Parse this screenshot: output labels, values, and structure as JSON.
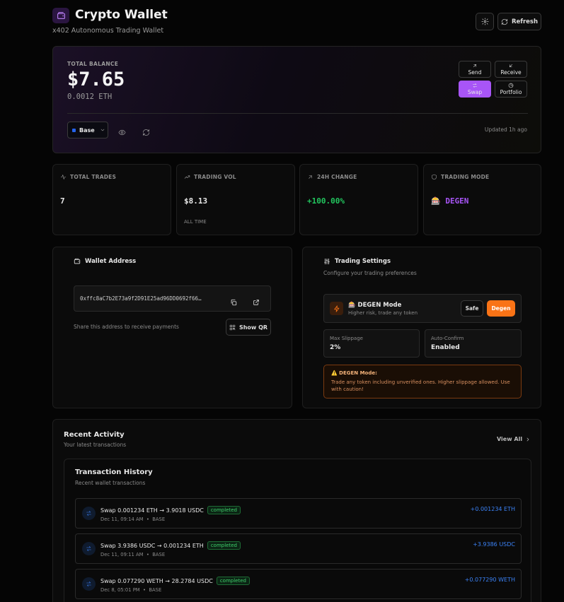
{
  "header": {
    "title": "Crypto Wallet",
    "subtitle": "x402 Autonomous Trading Wallet",
    "refresh_label": "Refresh"
  },
  "balance": {
    "label": "TOTAL BALANCE",
    "usd": "$7.65",
    "eth": "0.0012 ETH",
    "network": "Base",
    "updated": "Updated 1h ago",
    "actions": {
      "send": "Send",
      "receive": "Receive",
      "swap": "Swap",
      "portfolio": "Portfolio"
    }
  },
  "stats": [
    {
      "label": "TOTAL TRADES",
      "value": "7",
      "sub": ""
    },
    {
      "label": "TRADING VOL",
      "value": "$8.13",
      "sub": "ALL TIME"
    },
    {
      "label": "24H CHANGE",
      "value": "+100.00%",
      "sub": ""
    },
    {
      "label": "TRADING MODE",
      "value": "🎰 DEGEN",
      "sub": ""
    }
  ],
  "wallet": {
    "title": "Wallet Address",
    "address": "0xffc8aC7b2E73a9f2D91E25ad96DD0692f66…",
    "hint": "Share this address to receive payments",
    "qr_label": "Show QR"
  },
  "settings": {
    "title": "Trading Settings",
    "subtitle": "Configure your trading preferences",
    "mode_title": "🎰 DEGEN Mode",
    "mode_desc": "Higher risk, trade any token",
    "safe_label": "Safe",
    "degen_label": "Degen",
    "slippage_label": "Max Slippage",
    "slippage_value": "2%",
    "confirm_label": "Auto-Confirm",
    "confirm_value": "Enabled",
    "warn_title": "⚠️ DEGEN Mode:",
    "warn_text": "Trade any token including unverified ones. Higher slippage allowed. Use with caution!"
  },
  "activity": {
    "title": "Recent Activity",
    "subtitle": "Your latest transactions",
    "view_all": "View All",
    "history_title": "Transaction History",
    "history_subtitle": "Recent wallet transactions",
    "transactions": [
      {
        "title": "Swap 0.001234 ETH → 3.9018 USDC",
        "status": "completed",
        "date": "Dec 11, 09:14 AM",
        "chain": "BASE",
        "amount": "+0.001234 ETH"
      },
      {
        "title": "Swap 3.9386 USDC → 0.001234 ETH",
        "status": "completed",
        "date": "Dec 11, 09:11 AM",
        "chain": "BASE",
        "amount": "+3.9386 USDC"
      },
      {
        "title": "Swap 0.077290 WETH → 28.2784 USDC",
        "status": "completed",
        "date": "Dec 8, 05:01 PM",
        "chain": "BASE",
        "amount": "+0.077290 WETH"
      }
    ]
  },
  "colors": {
    "accent": "#a855f7",
    "degen": "#f97316",
    "positive": "#22c55e",
    "link": "#3b82f6"
  }
}
